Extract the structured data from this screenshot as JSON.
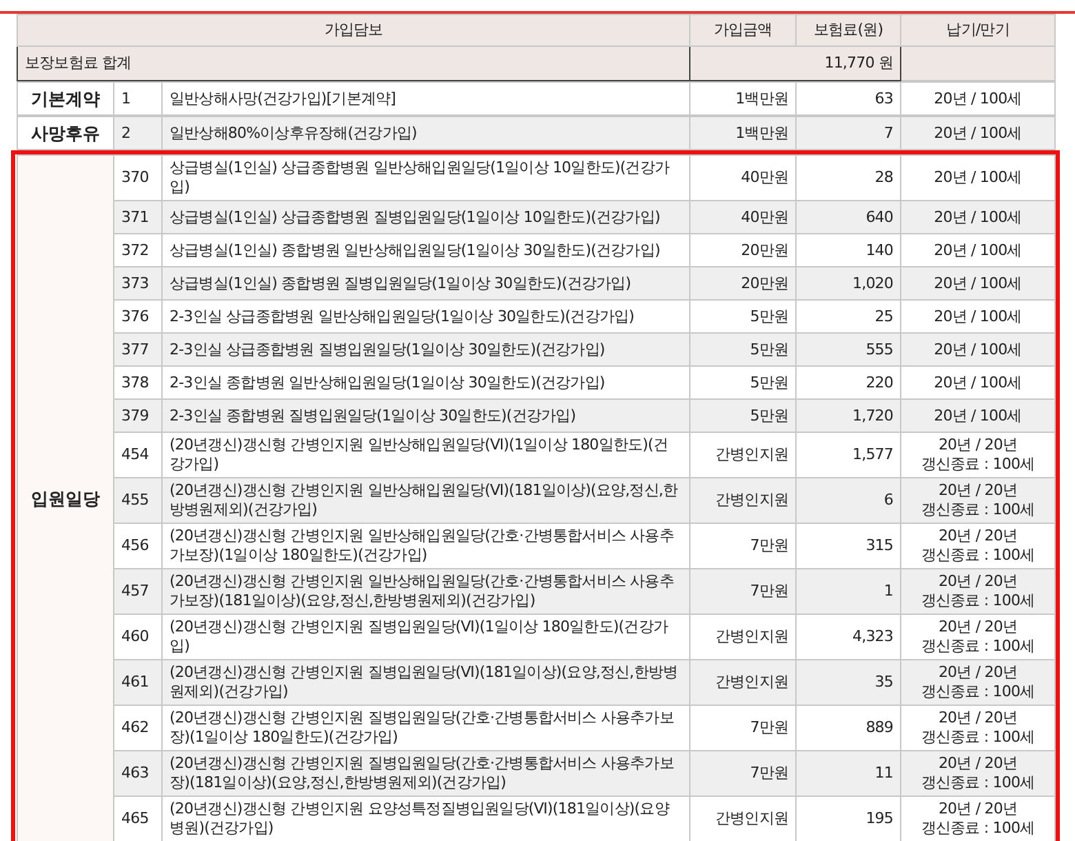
{
  "table": {
    "columns": [
      "가입담보",
      "가입금액",
      "보험료(원)",
      "납기/만기"
    ],
    "summary": {
      "label": "보장보험료 합계",
      "amount": "11,770 원"
    },
    "groups": [
      {
        "category": "기본계약",
        "highlighted": false,
        "rows": [
          {
            "no": "1",
            "name": "일반상해사망(건강가입)[기본계약]",
            "amount": "1백만원",
            "premium": "63",
            "term": [
              "20년 / 100세"
            ]
          }
        ]
      },
      {
        "category": "사망후유",
        "highlighted": false,
        "rows": [
          {
            "no": "2",
            "name": "일반상해80%이상후유장해(건강가입)",
            "amount": "1백만원",
            "premium": "7",
            "term": [
              "20년 / 100세"
            ]
          }
        ]
      },
      {
        "category": "입원일당",
        "highlighted": true,
        "rows": [
          {
            "no": "370",
            "name": "상급병실(1인실) 상급종합병원 일반상해입원일당(1일이상 10일한도)(건강가입)",
            "amount": "40만원",
            "premium": "28",
            "term": [
              "20년 / 100세"
            ]
          },
          {
            "no": "371",
            "name": "상급병실(1인실) 상급종합병원 질병입원일당(1일이상 10일한도)(건강가입)",
            "amount": "40만원",
            "premium": "640",
            "term": [
              "20년 / 100세"
            ]
          },
          {
            "no": "372",
            "name": "상급병실(1인실) 종합병원 일반상해입원일당(1일이상 30일한도)(건강가입)",
            "amount": "20만원",
            "premium": "140",
            "term": [
              "20년 / 100세"
            ]
          },
          {
            "no": "373",
            "name": "상급병실(1인실) 종합병원 질병입원일당(1일이상 30일한도)(건강가입)",
            "amount": "20만원",
            "premium": "1,020",
            "term": [
              "20년 / 100세"
            ]
          },
          {
            "no": "376",
            "name": "2-3인실 상급종합병원 일반상해입원일당(1일이상 30일한도)(건강가입)",
            "amount": "5만원",
            "premium": "25",
            "term": [
              "20년 / 100세"
            ]
          },
          {
            "no": "377",
            "name": "2-3인실 상급종합병원 질병입원일당(1일이상 30일한도)(건강가입)",
            "amount": "5만원",
            "premium": "555",
            "term": [
              "20년 / 100세"
            ]
          },
          {
            "no": "378",
            "name": "2-3인실 종합병원 일반상해입원일당(1일이상 30일한도)(건강가입)",
            "amount": "5만원",
            "premium": "220",
            "term": [
              "20년 / 100세"
            ]
          },
          {
            "no": "379",
            "name": "2-3인실 종합병원 질병입원일당(1일이상 30일한도)(건강가입)",
            "amount": "5만원",
            "premium": "1,720",
            "term": [
              "20년 / 100세"
            ]
          },
          {
            "no": "454",
            "name": "(20년갱신)갱신형 간병인지원 일반상해입원일당(Ⅵ)(1일이상 180일한도)(건강가입)",
            "amount": "간병인지원",
            "premium": "1,577",
            "term": [
              "20년 / 20년",
              "갱신종료 : 100세"
            ]
          },
          {
            "no": "455",
            "name": "(20년갱신)갱신형 간병인지원 일반상해입원일당(Ⅵ)(181일이상)(요양,정신,한방병원제외)(건강가입)",
            "amount": "간병인지원",
            "premium": "6",
            "term": [
              "20년 / 20년",
              "갱신종료 : 100세"
            ]
          },
          {
            "no": "456",
            "name": "(20년갱신)갱신형 간병인지원 일반상해입원일당(간호·간병통합서비스 사용추가보장)(1일이상 180일한도)(건강가입)",
            "amount": "7만원",
            "premium": "315",
            "term": [
              "20년 / 20년",
              "갱신종료 : 100세"
            ]
          },
          {
            "no": "457",
            "name": "(20년갱신)갱신형 간병인지원 일반상해입원일당(간호·간병통합서비스 사용추가보장)(181일이상)(요양,정신,한방병원제외)(건강가입)",
            "amount": "7만원",
            "premium": "1",
            "term": [
              "20년 / 20년",
              "갱신종료 : 100세"
            ]
          },
          {
            "no": "460",
            "name": "(20년갱신)갱신형 간병인지원 질병입원일당(Ⅵ)(1일이상 180일한도)(건강가입)",
            "amount": "간병인지원",
            "premium": "4,323",
            "term": [
              "20년 / 20년",
              "갱신종료 : 100세"
            ]
          },
          {
            "no": "461",
            "name": "(20년갱신)갱신형 간병인지원 질병입원일당(Ⅵ)(181일이상)(요양,정신,한방병원제외)(건강가입)",
            "amount": "간병인지원",
            "premium": "35",
            "term": [
              "20년 / 20년",
              "갱신종료 : 100세"
            ]
          },
          {
            "no": "462",
            "name": "(20년갱신)갱신형 간병인지원 질병입원일당(간호·간병통합서비스 사용추가보장)(1일이상 180일한도)(건강가입)",
            "amount": "7만원",
            "premium": "889",
            "term": [
              "20년 / 20년",
              "갱신종료 : 100세"
            ]
          },
          {
            "no": "463",
            "name": "(20년갱신)갱신형 간병인지원 질병입원일당(간호·간병통합서비스 사용추가보장)(181일이상)(요양,정신,한방병원제외)(건강가입)",
            "amount": "7만원",
            "premium": "11",
            "term": [
              "20년 / 20년",
              "갱신종료 : 100세"
            ]
          },
          {
            "no": "465",
            "name": "(20년갱신)갱신형 간병인지원 요양성특정질병입원일당(Ⅵ)(181일이상)(요양병원)(건강가입)",
            "amount": "간병인지원",
            "premium": "195",
            "term": [
              "20년 / 20년",
              "갱신종료 : 100세"
            ]
          }
        ]
      }
    ]
  }
}
